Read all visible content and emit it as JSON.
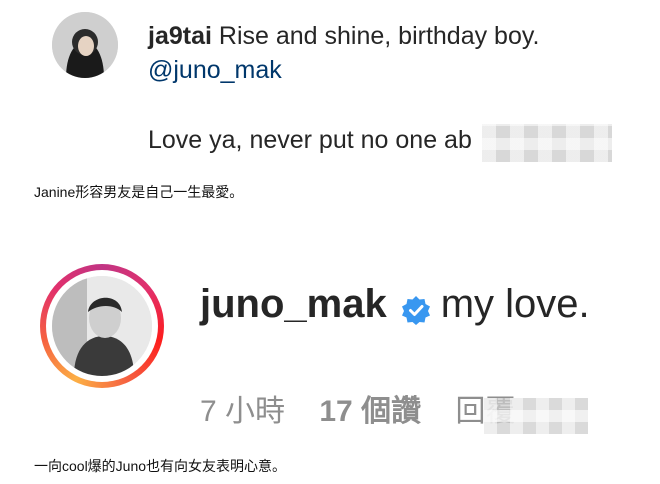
{
  "top_comment": {
    "username": "ja9tai",
    "text": "Rise and shine, birthday boy.",
    "mention": "@juno_mak",
    "second_line": "Love ya, never put no one ab"
  },
  "caption_1": "Janine形容男友是自己一生最愛。",
  "reply": {
    "username": "juno_mak",
    "text": "my love.",
    "time": "7 小時",
    "likes": "17 個讚",
    "reply_label": "回覆"
  },
  "caption_2": "一向cool爆的Juno也有向女友表明心意。",
  "colors": {
    "verified_badge": "#3897f0",
    "mention": "#00376b",
    "meta_text": "#8e8e8e"
  }
}
